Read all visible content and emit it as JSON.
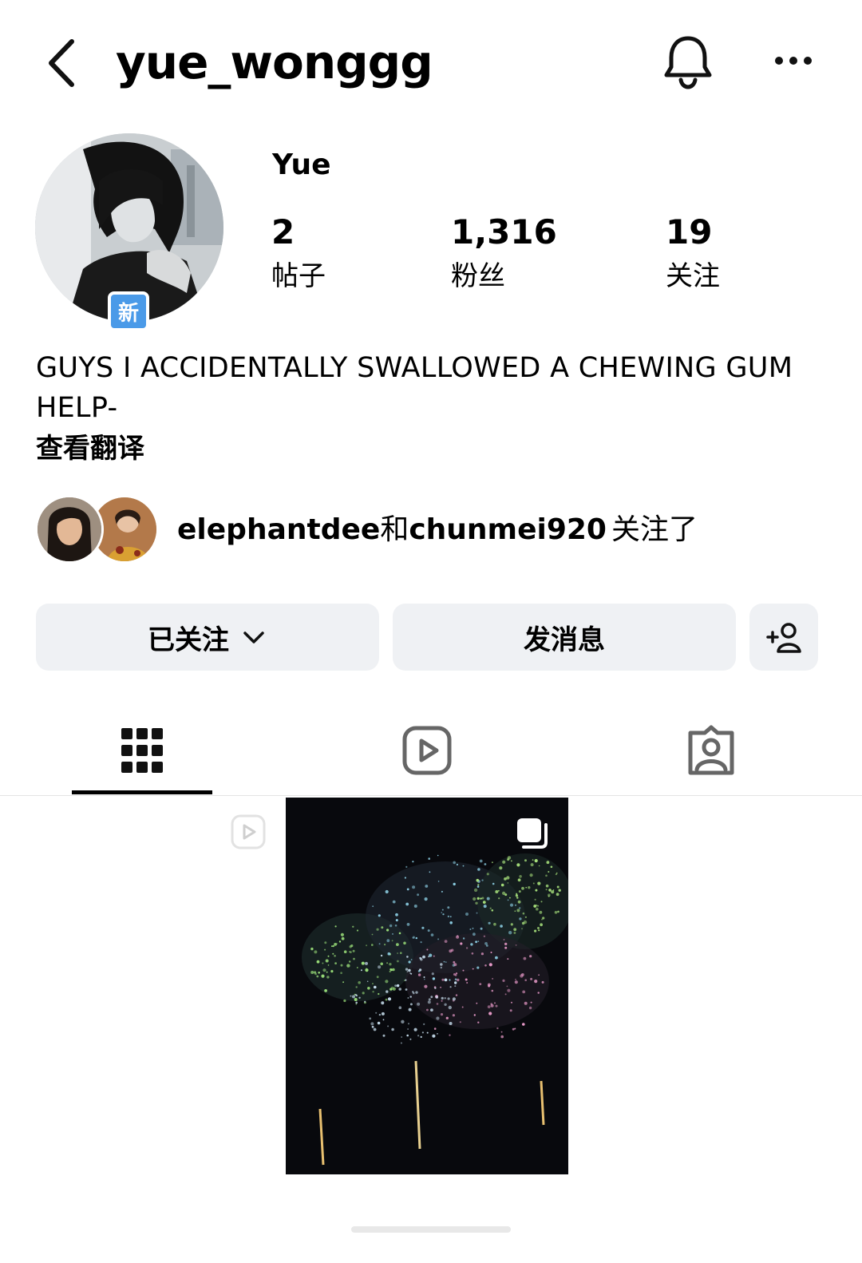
{
  "header": {
    "username": "yue_wonggg",
    "back_icon": "chevron-left-icon",
    "bell_icon": "bell-icon",
    "more_icon": "more-horizontal-icon"
  },
  "profile": {
    "display_name": "Yue",
    "new_badge": "新",
    "stats": [
      {
        "value": "2",
        "label": "帖子"
      },
      {
        "value": "1,316",
        "label": "粉丝"
      },
      {
        "value": "19",
        "label": "关注"
      }
    ],
    "bio": "GUYS I ACCIDENTALLY SWALLOWED A CHEWING GUM HELP-",
    "translate_label": "查看翻译"
  },
  "mutuals": {
    "user1": "elephantdee",
    "joiner": "和",
    "user2": "chunmei920",
    "suffix": "关注了"
  },
  "actions": {
    "following_label": "已关注",
    "message_label": "发消息",
    "add_person_icon": "add-person-icon"
  },
  "tabs": [
    {
      "icon": "grid-icon",
      "active": true
    },
    {
      "icon": "reels-icon",
      "active": false
    },
    {
      "icon": "tagged-icon",
      "active": false
    }
  ],
  "colors": {
    "background": "#ffffff",
    "button_bg": "#eff1f4",
    "badge_blue": "#4a9ae8",
    "text": "#000000"
  }
}
